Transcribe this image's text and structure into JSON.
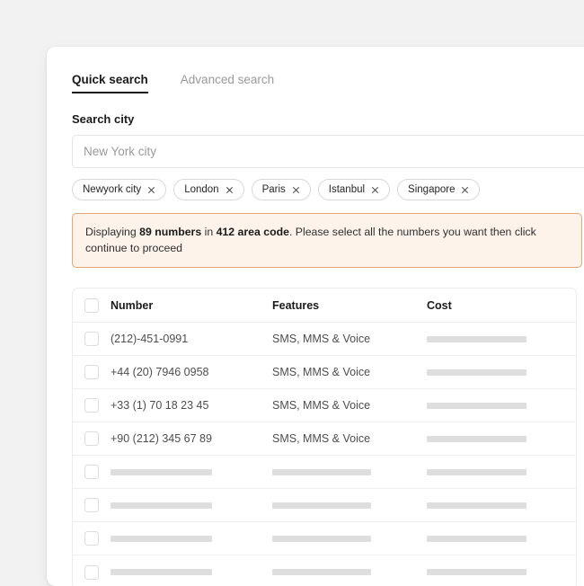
{
  "colors": {
    "page_background": "#f2f2f2",
    "card_background": "#ffffff",
    "accent_text": "#1a1a1a",
    "muted_text": "#9a9a9a",
    "alert_border": "#e5a775",
    "alert_background": "#fdf3ea",
    "skeleton": "#dedede"
  },
  "tabs": [
    {
      "label": "Quick search",
      "active": true
    },
    {
      "label": "Advanced search",
      "active": false
    }
  ],
  "search": {
    "label": "Search city",
    "value": "",
    "placeholder": "New York city"
  },
  "chips": [
    {
      "label": "Newyork city",
      "remove_icon": "close-icon"
    },
    {
      "label": "London",
      "remove_icon": "close-icon"
    },
    {
      "label": "Paris",
      "remove_icon": "close-icon"
    },
    {
      "label": "Istanbul",
      "remove_icon": "close-icon"
    },
    {
      "label": "Singapore",
      "remove_icon": "close-icon"
    }
  ],
  "alert": {
    "prefix": "Displaying ",
    "count": "89 numbers",
    "middle": " in ",
    "area_code": "412 area code",
    "suffix": ". Please select all the numbers you want then click continue to proceed"
  },
  "table": {
    "headers": {
      "select_all": "",
      "number": "Number",
      "features": "Features",
      "cost": "Cost"
    },
    "rows": [
      {
        "number": "(212)-451-0991",
        "features": "SMS, MMS & Voice",
        "cost": "",
        "skeleton": false
      },
      {
        "number": "+44 (20) 7946 0958",
        "features": "SMS, MMS & Voice",
        "cost": "",
        "skeleton": false
      },
      {
        "number": "+33 (1) 70 18 23 45",
        "features": "SMS, MMS & Voice",
        "cost": "",
        "skeleton": false
      },
      {
        "number": "+90 (212) 345 67 89",
        "features": "SMS, MMS & Voice",
        "cost": "",
        "skeleton": false
      },
      {
        "number": "",
        "features": "",
        "cost": "",
        "skeleton": true
      },
      {
        "number": "",
        "features": "",
        "cost": "",
        "skeleton": true
      },
      {
        "number": "",
        "features": "",
        "cost": "",
        "skeleton": true
      },
      {
        "number": "",
        "features": "",
        "cost": "",
        "skeleton": true
      }
    ]
  }
}
